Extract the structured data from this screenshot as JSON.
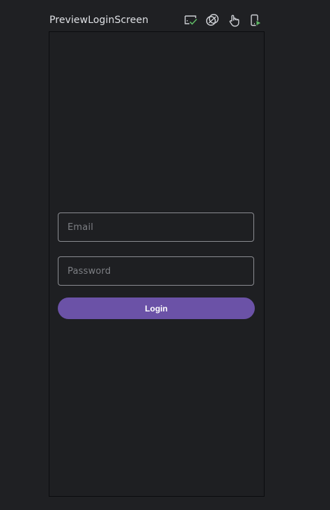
{
  "header": {
    "title": "PreviewLoginScreen",
    "toolbar_icons": [
      "check-mark-display-icon",
      "overlapping-rings-icon",
      "tap-hand-icon",
      "run-on-device-icon"
    ]
  },
  "form": {
    "email_placeholder": "Email",
    "password_placeholder": "Password",
    "login_label": "Login"
  },
  "colors": {
    "background": "#1f2023",
    "accent": "#6b52a7",
    "field_border": "#8b8d92",
    "placeholder_text": "#7d7f84",
    "check_green": "#5fb865"
  }
}
